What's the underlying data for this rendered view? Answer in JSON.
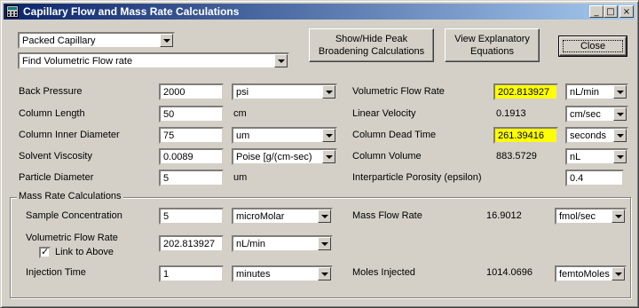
{
  "window": {
    "title": "Capillary Flow and Mass Rate Calculations",
    "controls": [
      "_",
      "□",
      "×"
    ]
  },
  "top": {
    "capillary_type": "Packed Capillary",
    "calc_mode": "Find Volumetric Flow rate",
    "show_hide_line1": "Show/Hide Peak",
    "show_hide_line2": "Broadening Calculations",
    "view_eq_line1": "View Explanatory",
    "view_eq_line2": "Equations",
    "close": "Close"
  },
  "left": {
    "back_pressure": {
      "label": "Back Pressure",
      "value": "2000",
      "unit": "psi"
    },
    "column_length": {
      "label": "Column Length",
      "value": "50",
      "unit": "cm"
    },
    "column_id": {
      "label": "Column Inner Diameter",
      "value": "75",
      "unit": "um"
    },
    "viscosity": {
      "label": "Solvent Viscosity",
      "value": "0.0089",
      "unit": "Poise [g/(cm-sec)"
    },
    "particle": {
      "label": "Particle Diameter",
      "value": "5",
      "unit": "um"
    }
  },
  "right": {
    "vol_flow": {
      "label": "Volumetric Flow Rate",
      "value": "202.813927",
      "unit": "nL/min"
    },
    "lin_vel": {
      "label": "Linear Velocity",
      "value": "0.1913",
      "unit": "cm/sec"
    },
    "dead_time": {
      "label": "Column Dead Time",
      "value": "261.39416",
      "unit": "seconds"
    },
    "col_vol": {
      "label": "Column Volume",
      "value": "883.5729",
      "unit": "nL"
    },
    "porosity": {
      "label": "Interparticle Porosity (epsilon)",
      "value": "0.4"
    }
  },
  "mass": {
    "group_title": "Mass Rate Calculations",
    "sample_conc": {
      "label": "Sample Concentration",
      "value": "5",
      "unit": "microMolar"
    },
    "vol_flow": {
      "label": "Volumetric Flow Rate",
      "value": "202.813927",
      "unit": "nL/min"
    },
    "link": "Link to Above",
    "inj_time": {
      "label": "Injection Time",
      "value": "1",
      "unit": "minutes"
    },
    "mass_flow": {
      "label": "Mass Flow Rate",
      "value": "16.9012",
      "unit": "fmol/sec"
    },
    "moles": {
      "label": "Moles Injected",
      "value": "1014.0696",
      "unit": "femtoMoles"
    }
  },
  "colors": {
    "highlight": "#ffff00",
    "title_start": "#0a246a",
    "title_end": "#a6caf0",
    "face": "#d4d0c8"
  }
}
